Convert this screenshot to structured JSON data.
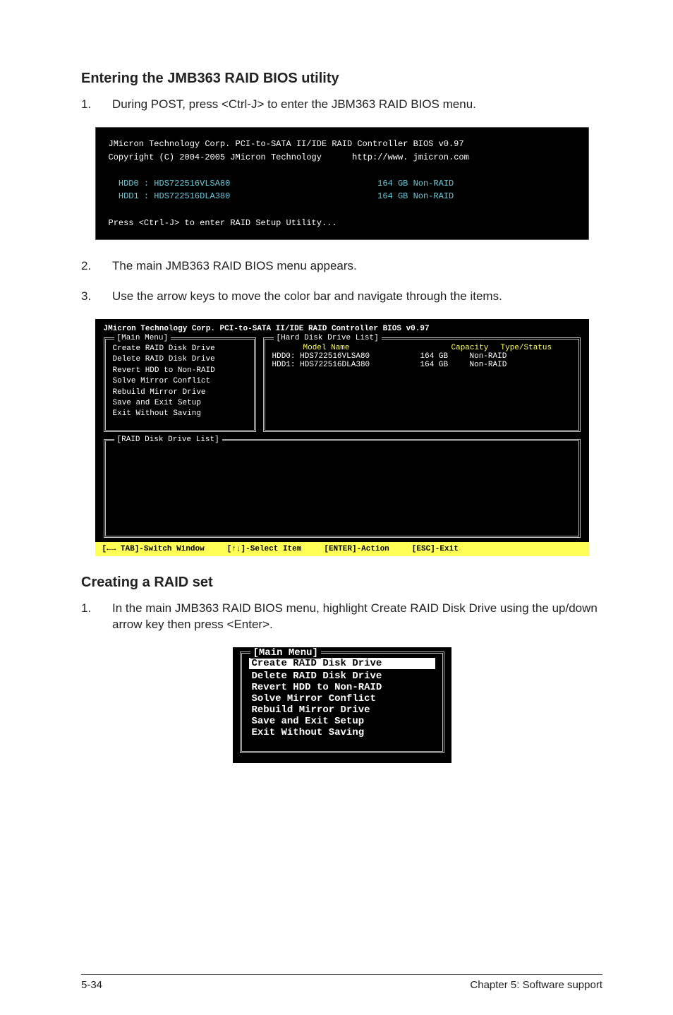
{
  "section1": {
    "heading": "Entering the JMB363 RAID BIOS utility",
    "step1": "During POST, press <Ctrl-J> to enter the JBM363 RAID BIOS menu."
  },
  "term": {
    "line1a": "JMicron Technology Corp. PCI-to-SATA II/IDE RAID Controller BIOS v0.97",
    "line2a": "Copyright (C) 2004-2005 JMicron Technology",
    "line2b": "http://www. jmicron.com",
    "hdd0a": "  HDD0 : HDS722516VLSA80",
    "hdd0b": "164 GB Non-RAID",
    "hdd1a": "  HDD1 : HDS722516DLA380",
    "hdd1b": "164 GB Non-RAID",
    "press": "Press <Ctrl-J> to enter RAID Setup Utility..."
  },
  "after1": {
    "step2": "The main JMB363 RAID BIOS menu appears.",
    "step3": "Use the arrow keys to move the color bar and navigate through the items."
  },
  "bios": {
    "title": "JMicron Technology Corp. PCI-to-SATA II/IDE RAID Controller BIOS v0.97",
    "main_label": "[Main Menu]",
    "hdd_label": "[Hard Disk Drive List]",
    "raid_label": "[RAID Disk Drive List]",
    "menu": {
      "i0": "Create RAID Disk Drive",
      "i1": "Delete RAID Disk Drive",
      "i2": "Revert HDD to Non-RAID",
      "i3": "Solve Mirror Conflict",
      "i4": "Rebuild Mirror Drive",
      "i5": "Save and Exit Setup",
      "i6": "Exit Without Saving"
    },
    "hdr": {
      "model": "Model Name",
      "cap": "Capacity",
      "type": "Type/Status"
    },
    "rows": [
      {
        "label": "HDD0:",
        "model": "HDS722516VLSA80",
        "cap": "164 GB",
        "type": "Non-RAID"
      },
      {
        "label": "HDD1:",
        "model": "HDS722516DLA380",
        "cap": "164 GB",
        "type": "Non-RAID"
      }
    ],
    "footer": {
      "a": "[←→ TAB]-Switch Window",
      "b": "[↑↓]-Select Item",
      "c": "[ENTER]-Action",
      "d": "[ESC]-Exit"
    }
  },
  "section2": {
    "heading": "Creating a RAID set",
    "step1": "In the main JMB363 RAID BIOS menu, highlight Create RAID Disk Drive using the up/down arrow key then press <Enter>."
  },
  "mini": {
    "title": "[Main Menu]",
    "i0": "Create RAID Disk Drive",
    "i1": "Delete RAID Disk Drive",
    "i2": "Revert HDD to Non-RAID",
    "i3": "Solve Mirror Conflict",
    "i4": "Rebuild Mirror Drive",
    "i5": "Save and Exit Setup",
    "i6": "Exit Without Saving"
  },
  "footer": {
    "left": "5-34",
    "right": "Chapter 5: Software support"
  }
}
